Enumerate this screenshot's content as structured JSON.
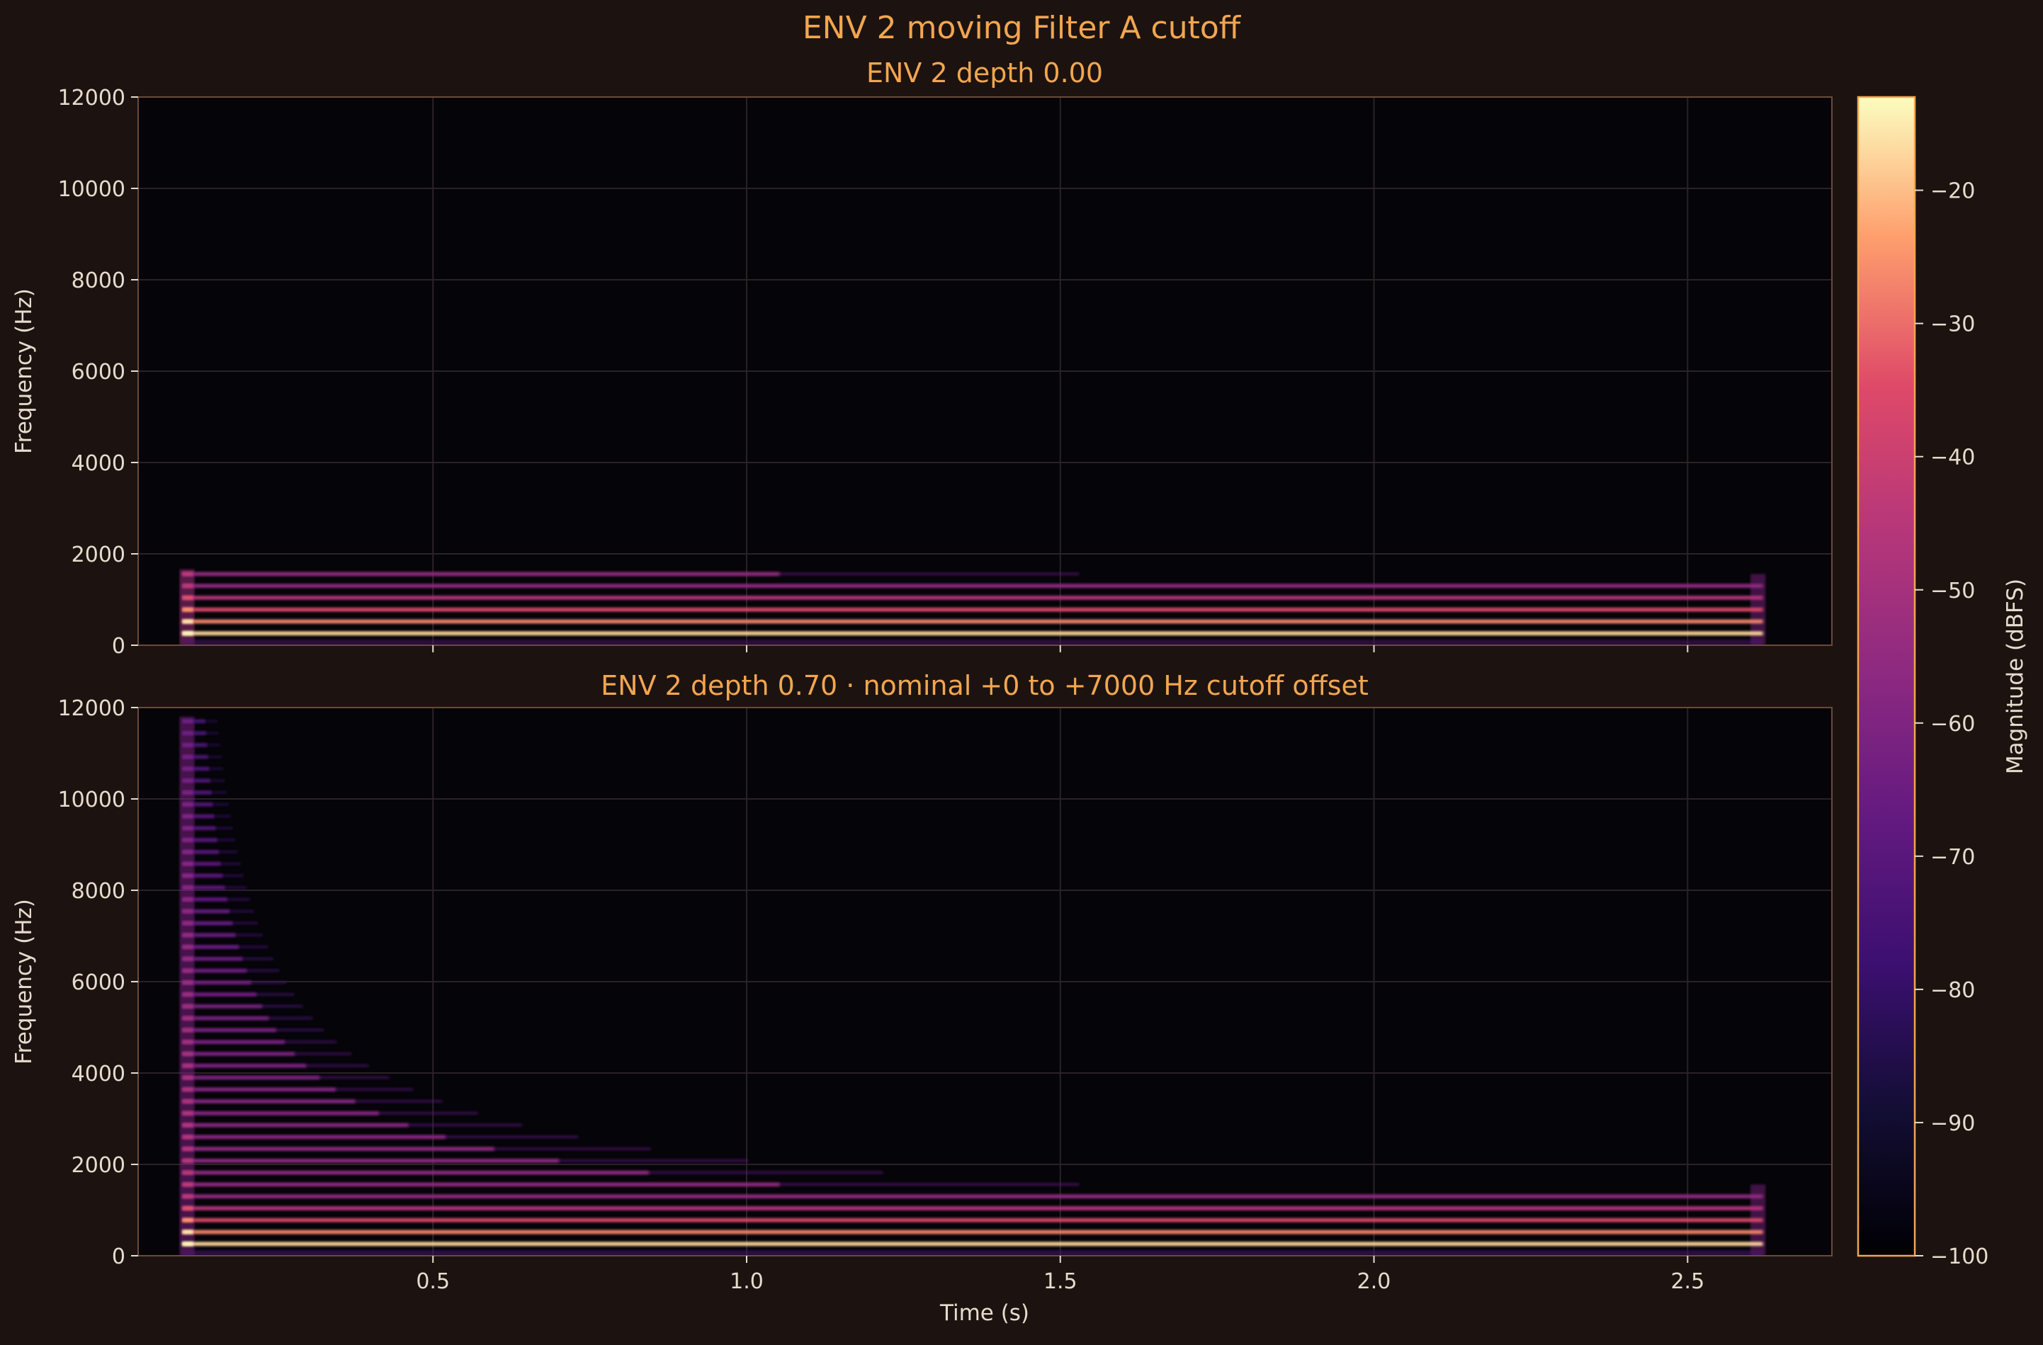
{
  "figure": {
    "suptitle": "ENV 2 moving Filter A cutoff",
    "background": "#1c1310",
    "plot_background": "#050408",
    "accent": "#f2a650",
    "text_color": "#e6dccd",
    "spine_color": "#6b4a39"
  },
  "colorbar": {
    "label": "Magnitude (dBFS)",
    "colormap": "magma",
    "range": [
      -100,
      -13
    ],
    "ticks": [
      -20,
      -30,
      -40,
      -50,
      -60,
      -70,
      -80,
      -90,
      -100
    ],
    "tick_labels": [
      "−20",
      "−30",
      "−40",
      "−50",
      "−60",
      "−70",
      "−80",
      "−90",
      "−100"
    ]
  },
  "chart_data": [
    {
      "type": "heatmap",
      "title": "ENV 2 depth 0.00",
      "xlabel": "",
      "ylabel": "Frequency (Hz)",
      "xlim": [
        0.03,
        2.73
      ],
      "ylim": [
        0,
        12000
      ],
      "x_ticks": [
        0.5,
        1.0,
        1.5,
        2.0,
        2.5
      ],
      "x_tick_labels": [],
      "y_ticks": [
        0,
        2000,
        4000,
        6000,
        8000,
        10000,
        12000
      ],
      "y_tick_labels": [
        "0",
        "2000",
        "4000",
        "6000",
        "8000",
        "10000",
        "12000"
      ],
      "grid": true,
      "note_onset_s": 0.1,
      "note_release_s": 2.62,
      "fundamental_hz": 260,
      "harmonic_count": 6,
      "env2_depth": 0.0,
      "cutoff_offset_hz": [
        0,
        0
      ]
    },
    {
      "type": "heatmap",
      "title": "ENV 2 depth 0.70 · nominal +0 to +7000 Hz cutoff offset",
      "xlabel": "Time (s)",
      "ylabel": "Frequency (Hz)",
      "xlim": [
        0.03,
        2.73
      ],
      "ylim": [
        0,
        12000
      ],
      "x_ticks": [
        0.5,
        1.0,
        1.5,
        2.0,
        2.5
      ],
      "x_tick_labels": [
        "0.5",
        "1.0",
        "1.5",
        "2.0",
        "2.5"
      ],
      "y_ticks": [
        0,
        2000,
        4000,
        6000,
        8000,
        10000,
        12000
      ],
      "y_tick_labels": [
        "0",
        "2000",
        "4000",
        "6000",
        "8000",
        "10000",
        "12000"
      ],
      "grid": true,
      "note_onset_s": 0.1,
      "note_release_s": 2.62,
      "fundamental_hz": 260,
      "harmonic_count": 45,
      "env2_depth": 0.7,
      "cutoff_offset_hz": [
        0,
        7000
      ]
    }
  ]
}
